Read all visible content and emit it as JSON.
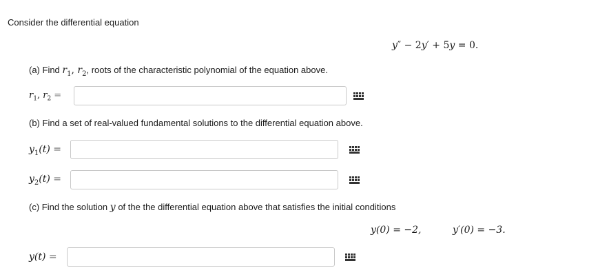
{
  "intro": "Consider the differential equation",
  "equation": {
    "y": "y",
    "pp": "″",
    "minus": " − ",
    "c1": "2",
    "y2": "y",
    "p": "′",
    "plus": " + ",
    "c2": "5",
    "y3": "y",
    "eq": " = 0."
  },
  "part_a": {
    "prompt_start": "(a) Find ",
    "r1": "r",
    "r1_sub": "1",
    "sep": ", ",
    "r2": "r",
    "r2_sub": "2",
    "prompt_end": ", roots of the characteristic polynomial of the equation above.",
    "label_r1": "r",
    "label_r1_sub": "1",
    "label_sep": ", ",
    "label_r2": "r",
    "label_r2_sub": "2",
    "label_eq": " =",
    "input_value": ""
  },
  "part_b": {
    "prompt": "(b) Find a set of real-valued fundamental solutions to the differential equation above.",
    "y1_label_y": "y",
    "y1_label_sub": "1",
    "y1_label_rest": "(t)",
    "y1_label_eq": " =",
    "y1_value": "",
    "y2_label_y": "y",
    "y2_label_sub": "2",
    "y2_label_rest": "(t)",
    "y2_label_eq": " =",
    "y2_value": ""
  },
  "part_c": {
    "prompt_start": "(c) Find the solution ",
    "prompt_var": "y",
    "prompt_end": " of the the differential equation above that satisfies the initial conditions",
    "ic1": "y(0) = −2,",
    "ic2_y": "y",
    "ic2_prime": "′",
    "ic2_rest": "(0) = −3.",
    "label_y": "y",
    "label_rest": "(t)",
    "label_eq": " =",
    "value": ""
  },
  "palette_icon": "matrix-grid-icon"
}
